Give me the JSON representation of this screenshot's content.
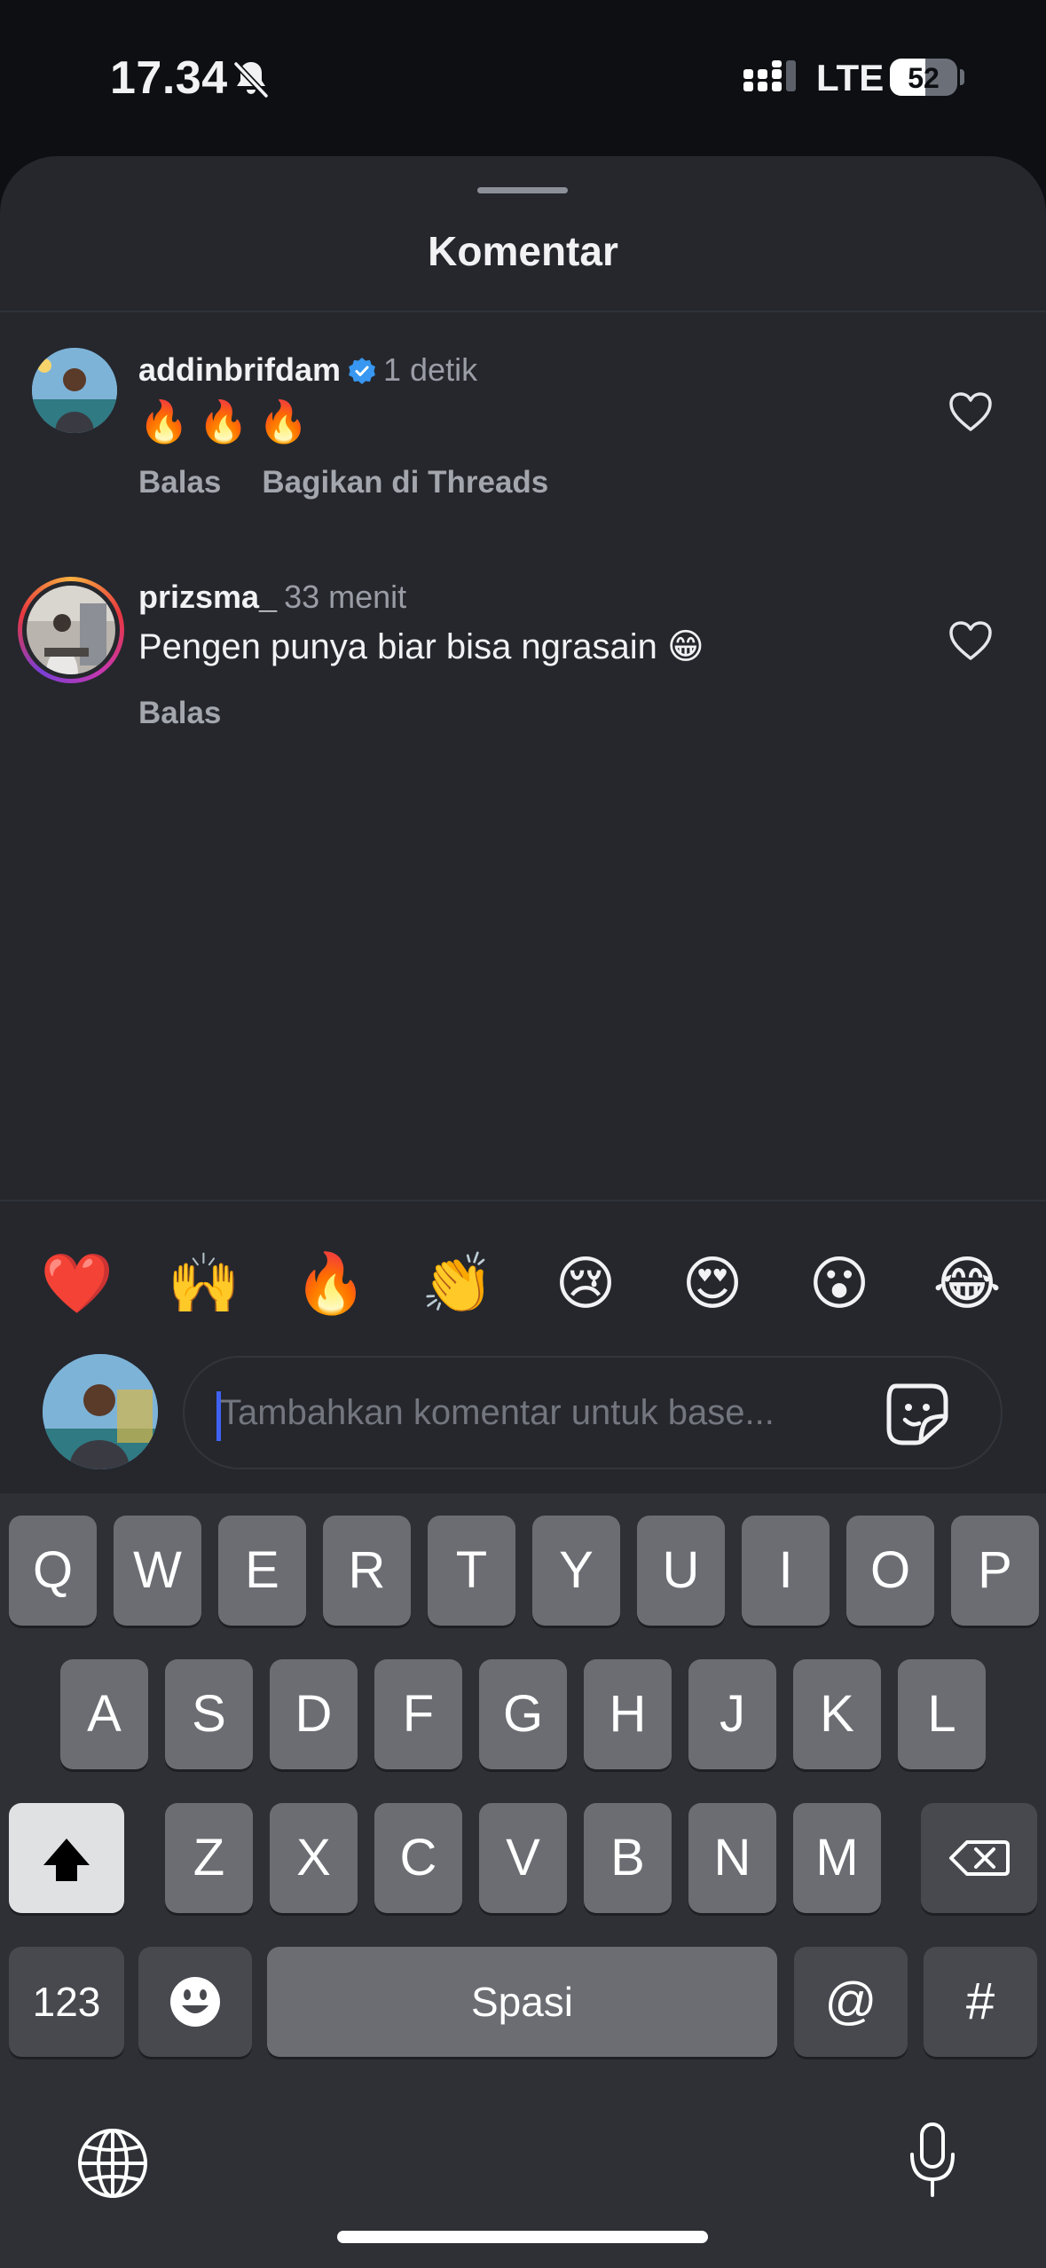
{
  "status_bar": {
    "time": "17.34",
    "silent_icon": "bell-slash-icon",
    "signal_icon": "cellular-signal-icon",
    "network": "LTE",
    "battery_percent": "52",
    "battery_level": 0.52
  },
  "sheet": {
    "title": "Komentar"
  },
  "comments": [
    {
      "username": "addinbrifdam",
      "verified": true,
      "time": "1 detik",
      "text": "🔥🔥🔥",
      "actions": [
        "Balas",
        "Bagikan di Threads"
      ],
      "like_icon": "heart-outline-icon"
    },
    {
      "username": "prizsma_",
      "verified": false,
      "has_story": true,
      "time": "33 menit",
      "text": "Pengen punya biar bisa ngrasain 😁",
      "actions": [
        "Balas"
      ],
      "like_icon": "heart-outline-icon"
    }
  ],
  "quick_reactions": [
    "❤️",
    "🙌",
    "🔥",
    "👏",
    "😢",
    "😍",
    "😮",
    "😂"
  ],
  "composer": {
    "placeholder": "Tambahkan komentar untuk base...",
    "sticker_icon": "sticker-icon"
  },
  "keyboard": {
    "row1": [
      "Q",
      "W",
      "E",
      "R",
      "T",
      "Y",
      "U",
      "I",
      "O",
      "P"
    ],
    "row2": [
      "A",
      "S",
      "D",
      "F",
      "G",
      "H",
      "J",
      "K",
      "L"
    ],
    "row3": [
      "Z",
      "X",
      "C",
      "V",
      "B",
      "N",
      "M"
    ],
    "numbers_key": "123",
    "space_key": "Spasi",
    "at_key": "@",
    "hash_key": "#",
    "shift_icon": "shift-icon",
    "delete_icon": "backspace-icon",
    "emoji_icon": "emoji-keyboard-icon",
    "globe_icon": "globe-icon",
    "mic_icon": "microphone-icon"
  },
  "colors": {
    "sheet_bg": "#25272d",
    "keyboard_bg": "#2e3035",
    "key_bg": "#6b6d72",
    "verified_blue": "#3897f0",
    "caret": "#3f62f3"
  }
}
